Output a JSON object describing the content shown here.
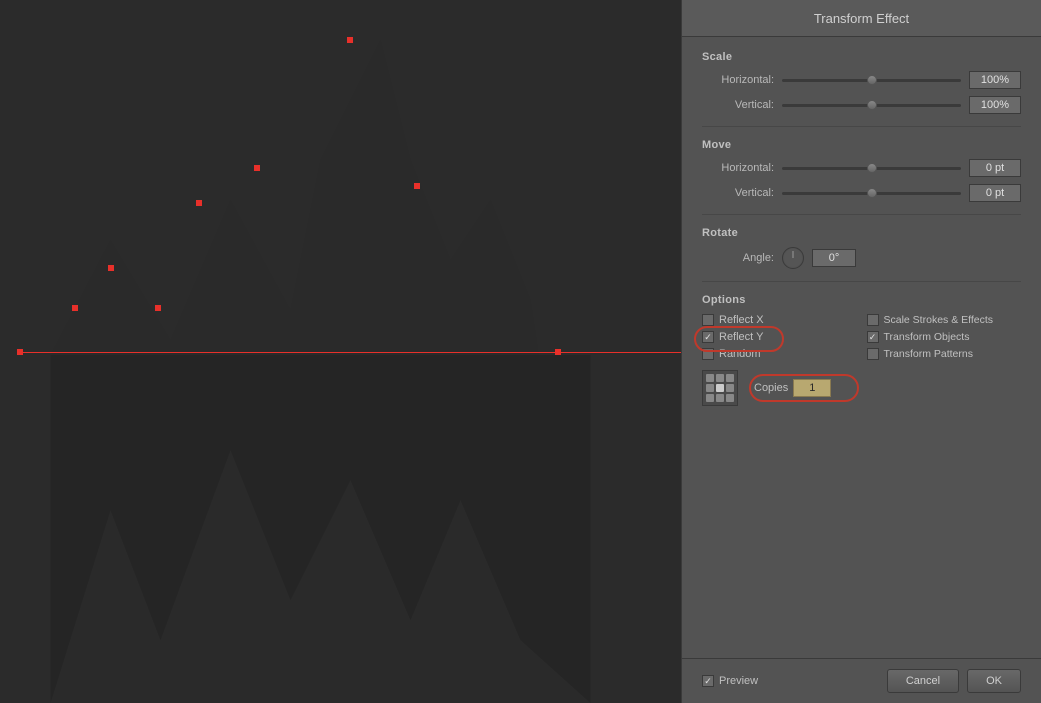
{
  "panel": {
    "title": "Transform Effect",
    "sections": {
      "scale": {
        "label": "Scale",
        "horizontal_label": "Horizontal:",
        "horizontal_value": "100%",
        "horizontal_slider_pos": "50%",
        "vertical_label": "Vertical:",
        "vertical_value": "100%",
        "vertical_slider_pos": "50%"
      },
      "move": {
        "label": "Move",
        "horizontal_label": "Horizontal:",
        "horizontal_value": "0 pt",
        "horizontal_slider_pos": "50%",
        "vertical_label": "Vertical:",
        "vertical_value": "0 pt",
        "vertical_slider_pos": "50%"
      },
      "rotate": {
        "label": "Rotate",
        "angle_label": "Angle:",
        "angle_value": "0°"
      },
      "options": {
        "label": "Options",
        "reflect_x_label": "Reflect X",
        "reflect_x_checked": false,
        "reflect_y_label": "Reflect Y",
        "reflect_y_checked": true,
        "random_label": "Random",
        "random_checked": false,
        "scale_strokes_label": "Scale Strokes & Effects",
        "scale_strokes_checked": false,
        "transform_objects_label": "Transform Objects",
        "transform_objects_checked": true,
        "transform_patterns_label": "Transform Patterns",
        "transform_patterns_checked": false
      },
      "copies": {
        "label": "Copies",
        "value": "1"
      }
    },
    "footer": {
      "preview_label": "Preview",
      "preview_checked": true,
      "cancel_label": "Cancel",
      "ok_label": "OK"
    }
  }
}
